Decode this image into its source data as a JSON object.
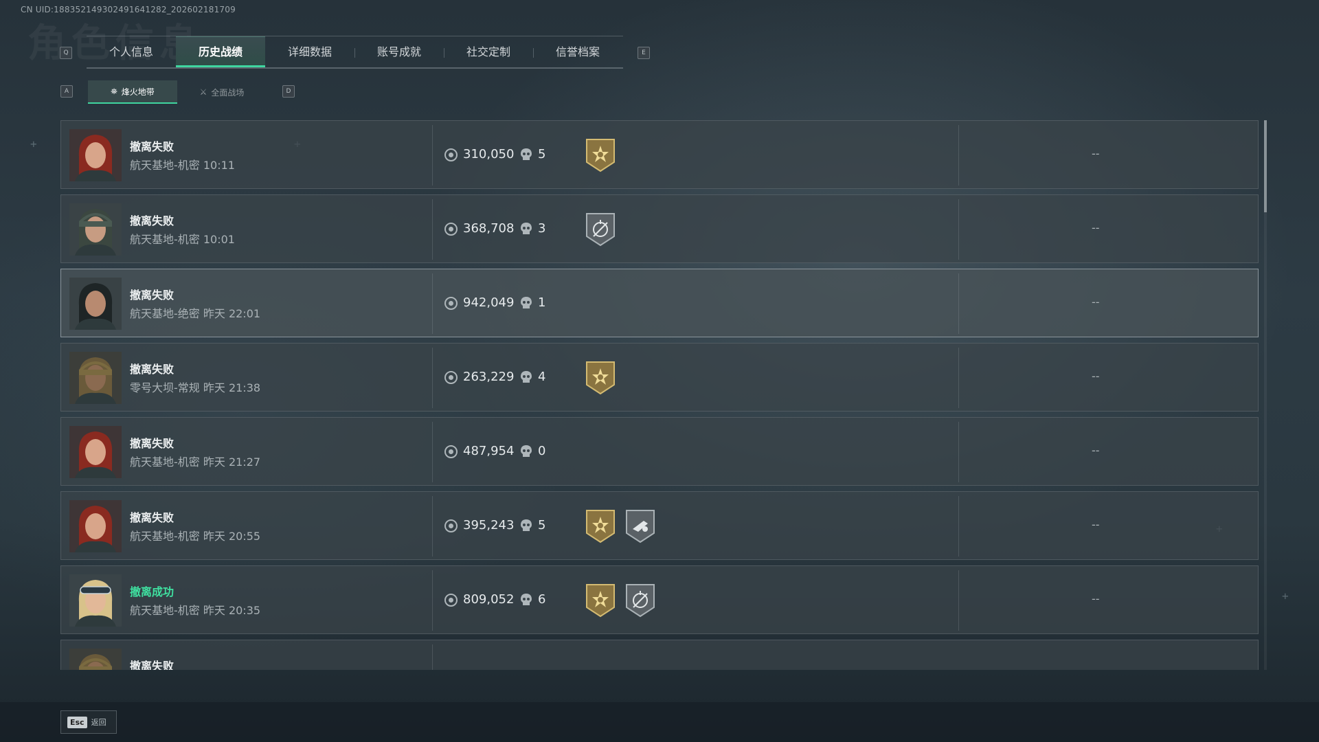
{
  "uid_text": "CN UID:188352149302491641282_202602181709",
  "background_title": "角色信息",
  "tab_key_left": "Q",
  "tab_key_right": "E",
  "tabs": [
    {
      "label": "个人信息",
      "active": false
    },
    {
      "label": "历史战绩",
      "active": true
    },
    {
      "label": "详细数据",
      "active": false
    },
    {
      "label": "账号成就",
      "active": false
    },
    {
      "label": "社交定制",
      "active": false
    },
    {
      "label": "信誉档案",
      "active": false
    }
  ],
  "subtab_key_left": "A",
  "subtab_key_right": "D",
  "subtabs": [
    {
      "label": "烽火地带",
      "icon": "extraction-icon",
      "active": true
    },
    {
      "label": "全面战场",
      "icon": "battlefield-icon",
      "active": false
    }
  ],
  "matches": [
    {
      "status": "撤离失败",
      "success": false,
      "map": "航天基地-机密 10:11",
      "value": "310,050",
      "kills": "5",
      "badges": [
        "gold-star-badge"
      ],
      "result": "--",
      "avatar": "red-hair-operator",
      "highlight": false
    },
    {
      "status": "撤离失败",
      "success": false,
      "map": "航天基地-机密 10:01",
      "value": "368,708",
      "kills": "3",
      "badges": [
        "silver-crosshair-badge"
      ],
      "result": "--",
      "avatar": "helmet-operator",
      "highlight": false
    },
    {
      "status": "撤离失败",
      "success": false,
      "map": "航天基地-绝密 昨天 22:01",
      "value": "942,049",
      "kills": "1",
      "badges": [],
      "result": "--",
      "avatar": "dark-hair-operator",
      "highlight": true
    },
    {
      "status": "撤离失败",
      "success": false,
      "map": "零号大坝-常规 昨天 21:38",
      "value": "263,229",
      "kills": "4",
      "badges": [
        "gold-star-badge"
      ],
      "result": "--",
      "avatar": "armored-operator",
      "highlight": false
    },
    {
      "status": "撤离失败",
      "success": false,
      "map": "航天基地-机密 昨天 21:27",
      "value": "487,954",
      "kills": "0",
      "badges": [],
      "result": "--",
      "avatar": "red-hair-operator",
      "highlight": false
    },
    {
      "status": "撤离失败",
      "success": false,
      "map": "航天基地-机密 昨天 20:55",
      "value": "395,243",
      "kills": "5",
      "badges": [
        "gold-star-badge",
        "silver-weapon-badge"
      ],
      "result": "--",
      "avatar": "red-hair-operator",
      "highlight": false
    },
    {
      "status": "撤离成功",
      "success": true,
      "map": "航天基地-机密 昨天 20:35",
      "value": "809,052",
      "kills": "6",
      "badges": [
        "gold-star-badge",
        "silver-crosshair-badge"
      ],
      "result": "--",
      "avatar": "goggles-operator",
      "highlight": false
    },
    {
      "status": "撤离失败",
      "success": false,
      "map": "",
      "value": "",
      "kills": "",
      "badges": [],
      "result": "",
      "avatar": "armored-operator",
      "highlight": false
    }
  ],
  "colors": {
    "accent": "#3fd6a0",
    "success_text": "#3fe0a0",
    "gold_badge": "#b39a55",
    "silver_badge": "#9aa3a8"
  },
  "footer": {
    "esc_key": "Esc",
    "esc_label": "返回"
  }
}
